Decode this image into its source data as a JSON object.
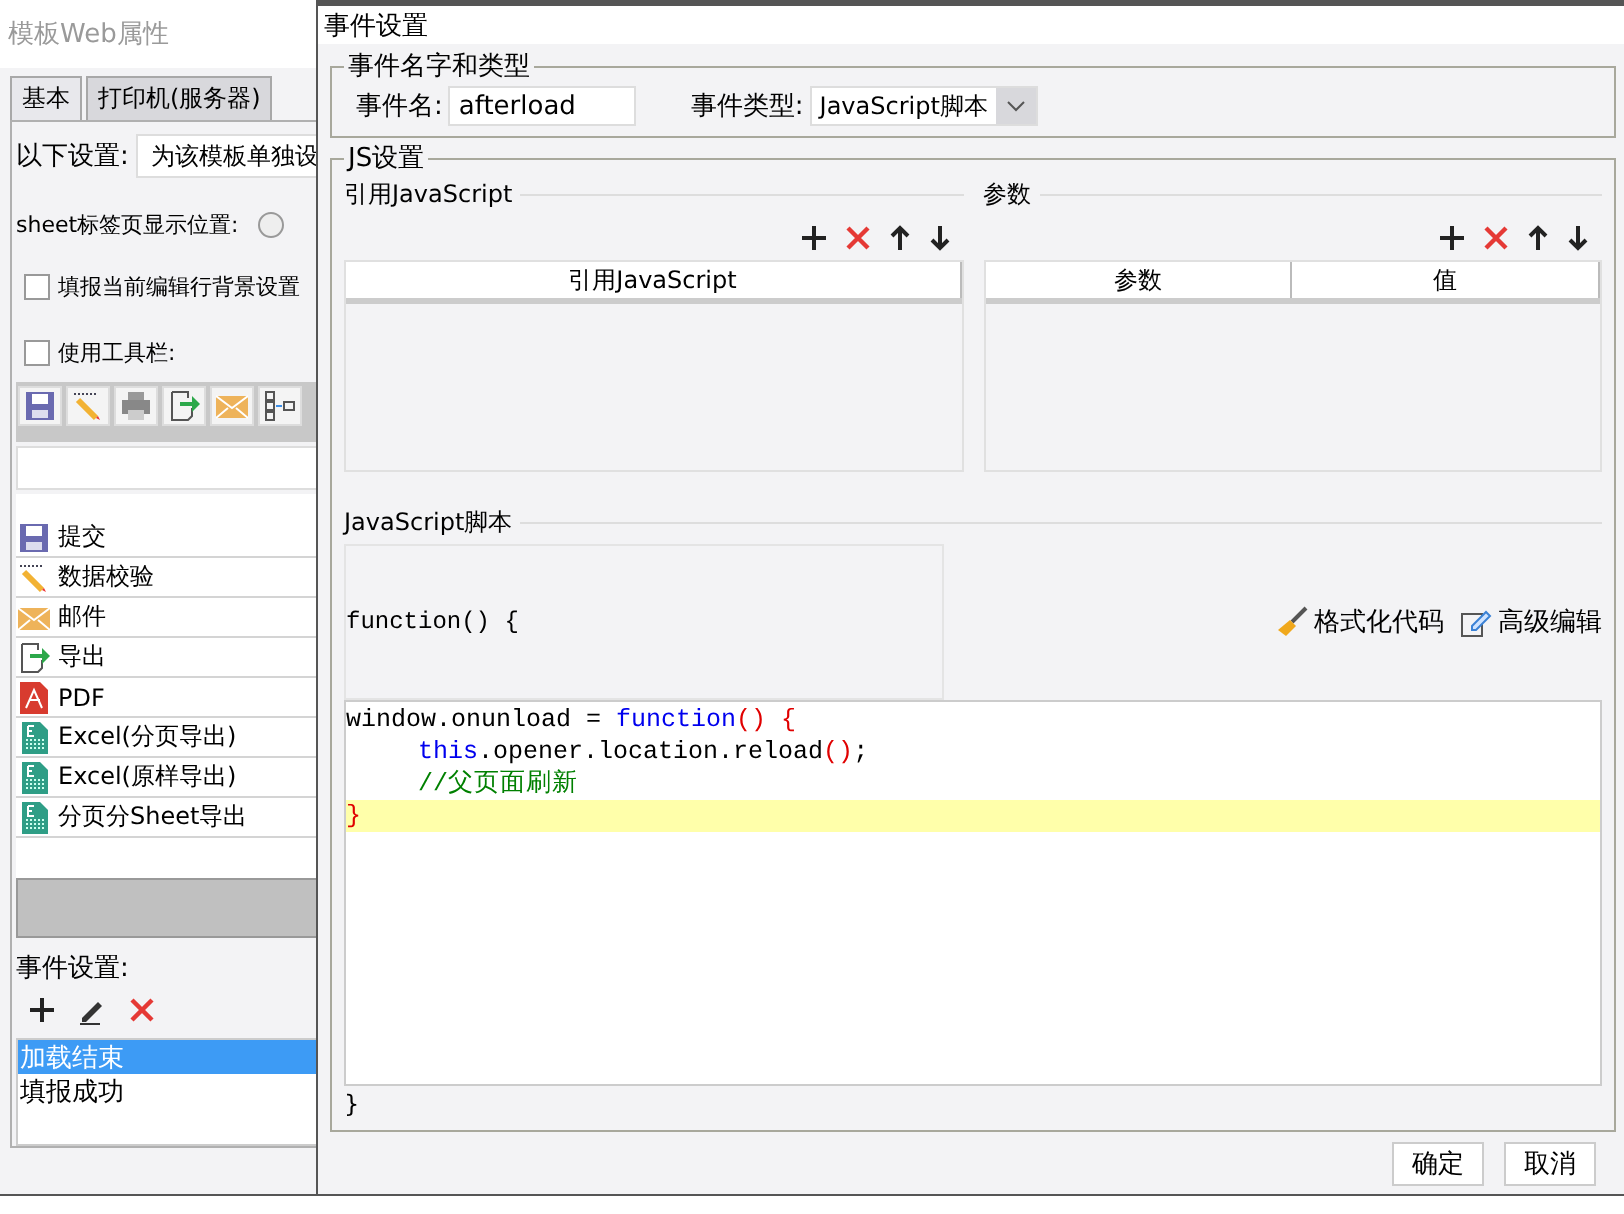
{
  "background_window": {
    "title": "模板Web属性",
    "tabs": [
      {
        "label": "基本",
        "selected": true
      },
      {
        "label": "打印机(服务器)",
        "selected": false
      }
    ],
    "settings": {
      "label": "以下设置:",
      "value": "为该模板单独设"
    },
    "sheet_tab": {
      "label": "sheet标签页显示位置:",
      "selected": false
    },
    "checkboxes": [
      {
        "label": "填报当前编辑行背景设置",
        "checked": false
      },
      {
        "label": "使用工具栏:",
        "checked": false
      }
    ],
    "toolbar_icons": [
      {
        "kind": "save"
      },
      {
        "kind": "pencil"
      },
      {
        "kind": "printer"
      },
      {
        "kind": "export"
      },
      {
        "kind": "mail"
      },
      {
        "kind": "layout"
      }
    ],
    "toolbar_items": [
      {
        "kind": "save",
        "label": "提交"
      },
      {
        "kind": "pencil",
        "label": "数据校验"
      },
      {
        "kind": "mail",
        "label": "邮件"
      },
      {
        "kind": "export",
        "label": "导出"
      },
      {
        "kind": "pdf",
        "label": "PDF"
      },
      {
        "kind": "excel",
        "label": "Excel(分页导出)"
      },
      {
        "kind": "excel",
        "label": "Excel(原样导出)"
      },
      {
        "kind": "excel",
        "label": "分页分Sheet导出"
      }
    ],
    "events_label": "事件设置:",
    "events": [
      {
        "label": "加载结束",
        "selected": true
      },
      {
        "label": "填报成功",
        "selected": false
      }
    ]
  },
  "dialog": {
    "title": "事件设置",
    "name_group": {
      "legend": "事件名字和类型",
      "name_label": "事件名:",
      "name_value": "afterload",
      "type_label": "事件类型:",
      "type_value": "JavaScript脚本"
    },
    "js_group": {
      "legend": "JS设置",
      "references": {
        "title": "引用JavaScript",
        "columns": [
          "引用JavaScript"
        ]
      },
      "parameters": {
        "title": "参数",
        "columns": [
          "参数",
          "值"
        ]
      },
      "script_title": "JavaScript脚本",
      "function_header": "function() {",
      "actions": [
        {
          "kind": "format",
          "label": "格式化代码"
        },
        {
          "kind": "edit",
          "label": "高级编辑"
        }
      ],
      "code_lines": [
        {
          "indented": false,
          "highlighted": false,
          "tokens": [
            {
              "kind": "plain",
              "text": "window.onunload = "
            },
            {
              "kind": "keyword",
              "text": "function"
            },
            {
              "kind": "punct",
              "text": "() {"
            }
          ]
        },
        {
          "indented": true,
          "highlighted": false,
          "tokens": [
            {
              "kind": "keyword",
              "text": "this"
            },
            {
              "kind": "plain",
              "text": ".opener.location.reload"
            },
            {
              "kind": "punct",
              "text": "()"
            },
            {
              "kind": "plain",
              "text": ";"
            }
          ]
        },
        {
          "indented": true,
          "highlighted": false,
          "tokens": [
            {
              "kind": "comment",
              "text": "//父页面刷新"
            }
          ]
        },
        {
          "indented": false,
          "highlighted": true,
          "tokens": [
            {
              "kind": "punct",
              "text": "}"
            }
          ]
        }
      ],
      "function_footer": "}"
    },
    "buttons": [
      {
        "label": "确定"
      },
      {
        "label": "取消"
      }
    ]
  }
}
